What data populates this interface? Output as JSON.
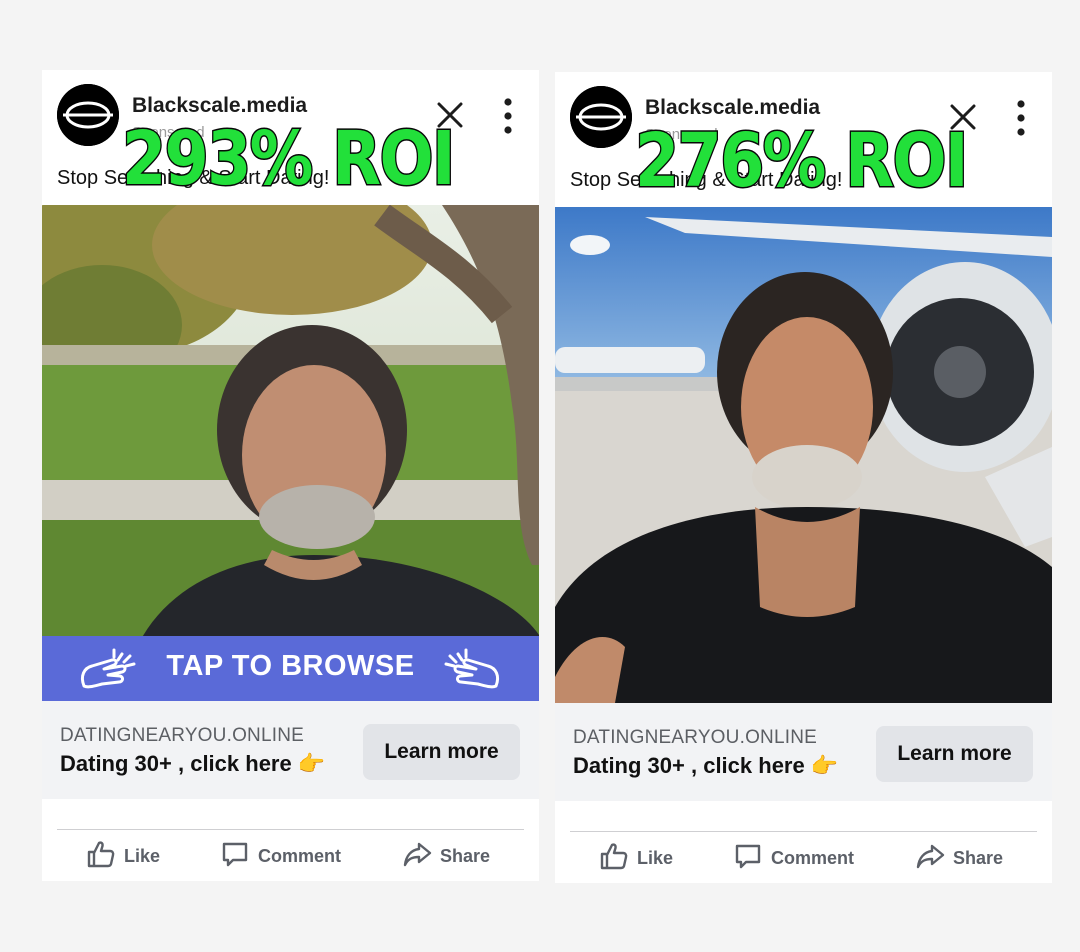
{
  "colors": {
    "roi_green": "#22e03a",
    "cta_blue": "#5a6ad8"
  },
  "ads": [
    {
      "page_name": "Blackscale.media",
      "sponsored": "Sponsored",
      "primary_text": "Stop Searching & Start Dating!",
      "roi_overlay": "293% ROI",
      "cta_banner": "TAP TO BROWSE",
      "link_domain": "DATINGNEARYOU.ONLINE",
      "link_headline": "Dating 30+ , click here 👉",
      "learn_more": "Learn more",
      "actions": {
        "like": "Like",
        "comment": "Comment",
        "share": "Share"
      },
      "icons": [
        "close-icon",
        "more-icon",
        "tap-hand-icon",
        "like-icon",
        "comment-icon",
        "share-icon"
      ]
    },
    {
      "page_name": "Blackscale.media",
      "sponsored": "Sponsored",
      "primary_text": "Stop Searching & Start Dating!",
      "roi_overlay": "276% ROI",
      "link_domain": "DATINGNEARYOU.ONLINE",
      "link_headline": "Dating 30+ , click here 👉",
      "learn_more": "Learn more",
      "actions": {
        "like": "Like",
        "comment": "Comment",
        "share": "Share"
      },
      "icons": [
        "close-icon",
        "more-icon",
        "like-icon",
        "comment-icon",
        "share-icon"
      ]
    }
  ]
}
